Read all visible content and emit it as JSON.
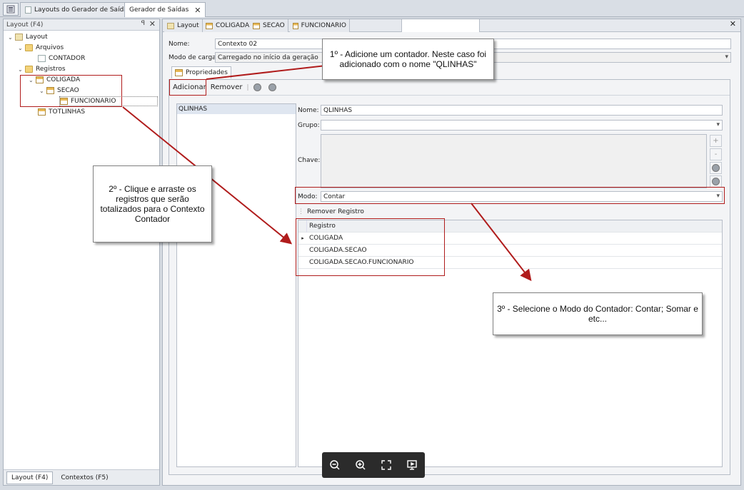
{
  "doc_tabs": [
    {
      "label": "Layouts do Gerador de Saídas"
    },
    {
      "label": "Gerador de Saídas"
    }
  ],
  "left_panel": {
    "title": "Layout (F4)",
    "tree": [
      "Layout",
      "Arquivos",
      "CONTADOR",
      "Registros",
      "COLIGADA",
      "SECAO",
      "FUNCIONARIO",
      "TOTLINHAS"
    ],
    "bottom_tabs": [
      "Layout (F4)",
      "Contextos (F5)"
    ]
  },
  "main": {
    "tabs": [
      "Layout",
      "COLIGADA",
      "SECAO",
      "FUNCIONARIO"
    ],
    "nome_label": "Nome:",
    "nome_value": "Contexto 02",
    "modo_carga_label": "Modo de carga:",
    "modo_carga_value": "Carregado no início da geração",
    "propriedades_tab": "Propriedades",
    "toolbar": {
      "adicionar": "Adicionar",
      "remover": "Remover"
    },
    "list_items": [
      "QLINHAS"
    ],
    "props": {
      "nome_label": "Nome:",
      "nome_value": "QLINHAS",
      "grupo_label": "Grupo:",
      "chave_label": "Chave:",
      "modo_label": "Modo:",
      "modo_value": "Contar",
      "remover_registro": "Remover Registro",
      "grid_header": "Registro",
      "grid_rows": [
        "COLIGADA",
        "COLIGADA.SECAO",
        "COLIGADA.SECAO.FUNCIONARIO"
      ]
    }
  },
  "callouts": {
    "c1": "1º - Adicione um contador. Neste caso foi adicionado com o nome \"QLINHAS\"",
    "c2": "2º - Clique e arraste os registros que serão totalizados para o Contexto Contador",
    "c3": "3º - Selecione o Modo do Contador: Contar; Somar e etc..."
  },
  "colors": {
    "annotation": "#b01c1c",
    "viewer_bar": "#2b2b2b"
  },
  "viewer_icons": [
    "zoom-out-icon",
    "zoom-in-icon",
    "fullscreen-icon",
    "presentation-icon"
  ]
}
